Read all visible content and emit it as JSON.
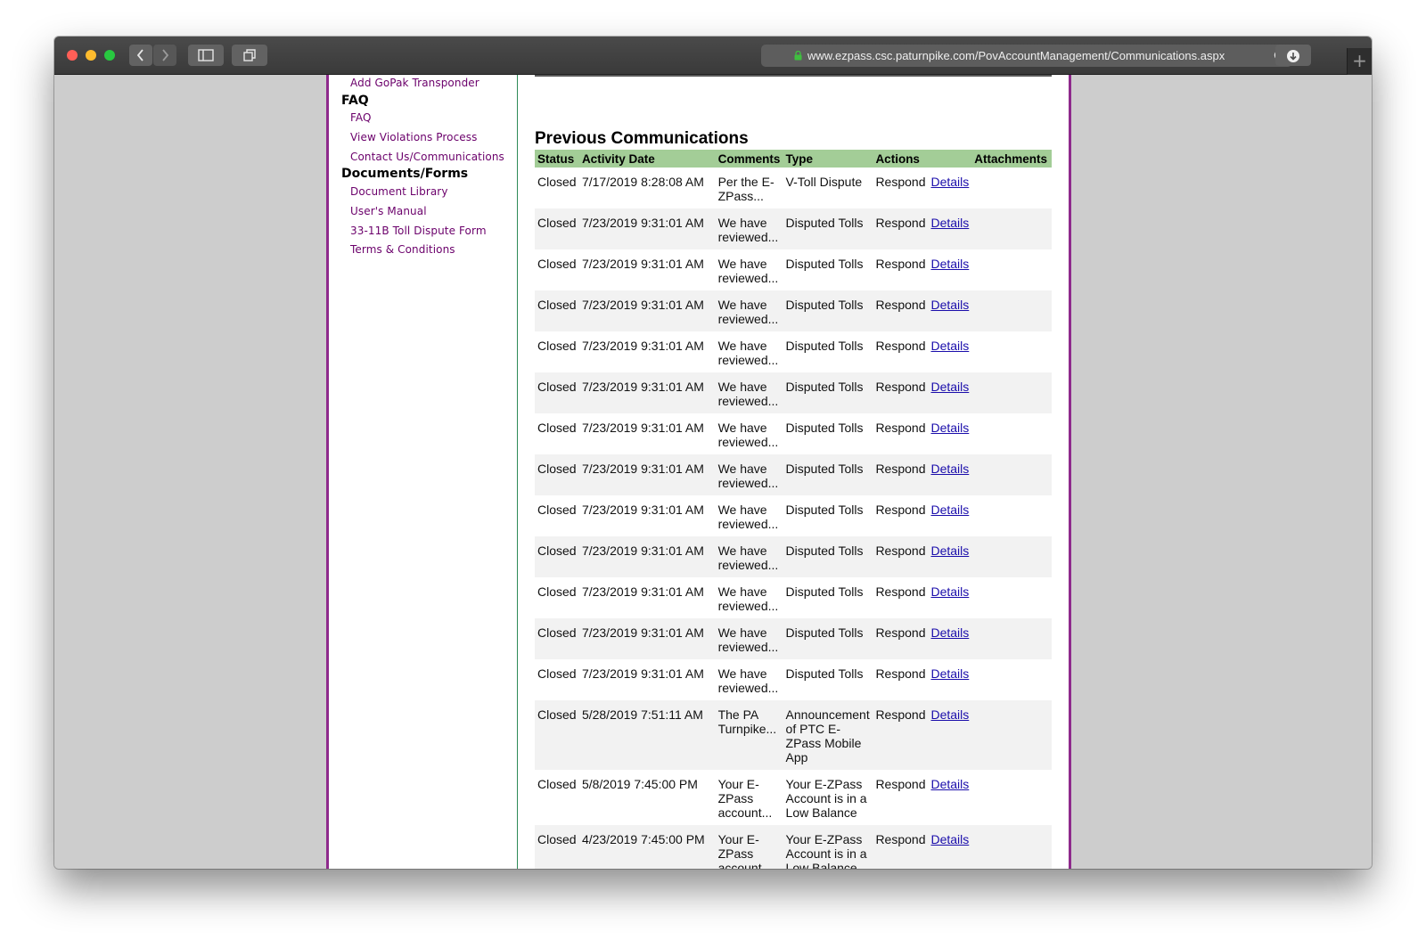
{
  "browser": {
    "url": "www.ezpass.csc.paturnpike.com/PovAccountManagement/Communications.aspx",
    "new_tab": "+"
  },
  "sidebar": {
    "top_link": "Add GoPak Transponder",
    "sections": [
      {
        "heading": "FAQ",
        "links": [
          "FAQ",
          "View Violations Process",
          "Contact Us/Communications"
        ]
      },
      {
        "heading": "Documents/Forms",
        "links": [
          "Document Library",
          "User's Manual",
          "33-11B Toll Dispute Form",
          "Terms & Conditions"
        ]
      }
    ]
  },
  "main": {
    "title": "Previous Communications",
    "columns": [
      "Status",
      "Activity Date",
      "Comments",
      "Type",
      "Actions",
      "Attachments"
    ],
    "rows": [
      {
        "status": "Closed",
        "date": "7/17/2019 8:28:08 AM",
        "comment": "Per the E-ZPass...",
        "type": "V-Toll Dispute",
        "action": "Respond",
        "link": "Details"
      },
      {
        "status": "Closed",
        "date": "7/23/2019 9:31:01 AM",
        "comment": "We have reviewed...",
        "type": "Disputed Tolls",
        "action": "Respond",
        "link": "Details"
      },
      {
        "status": "Closed",
        "date": "7/23/2019 9:31:01 AM",
        "comment": "We have reviewed...",
        "type": "Disputed Tolls",
        "action": "Respond",
        "link": "Details"
      },
      {
        "status": "Closed",
        "date": "7/23/2019 9:31:01 AM",
        "comment": "We have reviewed...",
        "type": "Disputed Tolls",
        "action": "Respond",
        "link": "Details"
      },
      {
        "status": "Closed",
        "date": "7/23/2019 9:31:01 AM",
        "comment": "We have reviewed...",
        "type": "Disputed Tolls",
        "action": "Respond",
        "link": "Details"
      },
      {
        "status": "Closed",
        "date": "7/23/2019 9:31:01 AM",
        "comment": "We have reviewed...",
        "type": "Disputed Tolls",
        "action": "Respond",
        "link": "Details"
      },
      {
        "status": "Closed",
        "date": "7/23/2019 9:31:01 AM",
        "comment": "We have reviewed...",
        "type": "Disputed Tolls",
        "action": "Respond",
        "link": "Details"
      },
      {
        "status": "Closed",
        "date": "7/23/2019 9:31:01 AM",
        "comment": "We have reviewed...",
        "type": "Disputed Tolls",
        "action": "Respond",
        "link": "Details"
      },
      {
        "status": "Closed",
        "date": "7/23/2019 9:31:01 AM",
        "comment": "We have reviewed...",
        "type": "Disputed Tolls",
        "action": "Respond",
        "link": "Details"
      },
      {
        "status": "Closed",
        "date": "7/23/2019 9:31:01 AM",
        "comment": "We have reviewed...",
        "type": "Disputed Tolls",
        "action": "Respond",
        "link": "Details"
      },
      {
        "status": "Closed",
        "date": "7/23/2019 9:31:01 AM",
        "comment": "We have reviewed...",
        "type": "Disputed Tolls",
        "action": "Respond",
        "link": "Details"
      },
      {
        "status": "Closed",
        "date": "7/23/2019 9:31:01 AM",
        "comment": "We have reviewed...",
        "type": "Disputed Tolls",
        "action": "Respond",
        "link": "Details"
      },
      {
        "status": "Closed",
        "date": "7/23/2019 9:31:01 AM",
        "comment": "We have reviewed...",
        "type": "Disputed Tolls",
        "action": "Respond",
        "link": "Details"
      },
      {
        "status": "Closed",
        "date": "5/28/2019 7:51:11 AM",
        "comment": "The PA Turnpike...",
        "type": "Announcement of PTC E-ZPass Mobile App",
        "action": "Respond",
        "link": "Details"
      },
      {
        "status": "Closed",
        "date": "5/8/2019 7:45:00 PM",
        "comment": "Your E-ZPass account...",
        "type": "Your E-ZPass Account is in a Low Balance",
        "action": "Respond",
        "link": "Details"
      },
      {
        "status": "Closed",
        "date": "4/23/2019 7:45:00 PM",
        "comment": "Your E-ZPass account...",
        "type": "Your E-ZPass Account is in a Low Balance",
        "action": "Respond",
        "link": "Details"
      }
    ]
  }
}
